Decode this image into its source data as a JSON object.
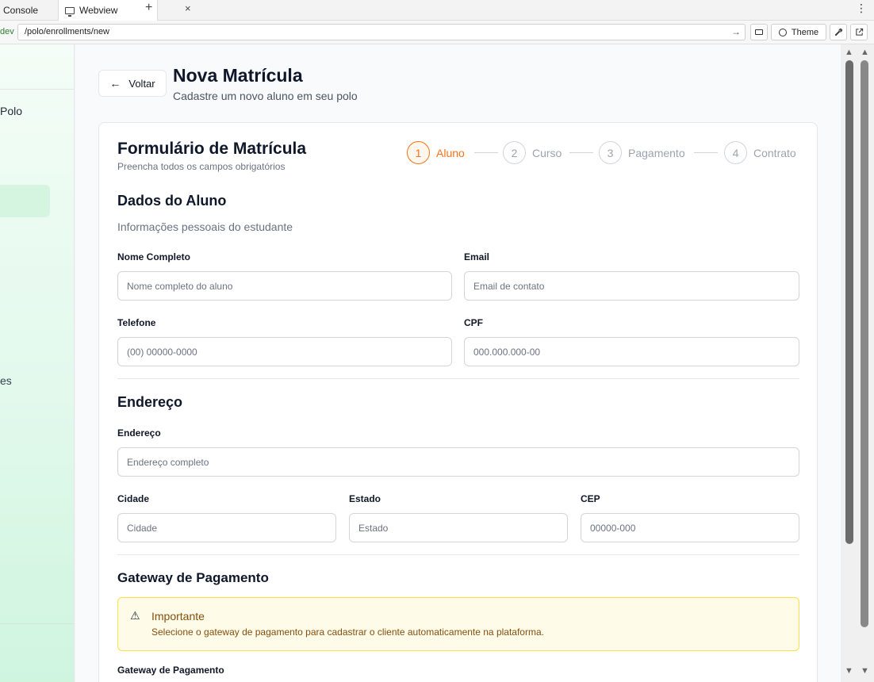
{
  "browser": {
    "tabs": [
      {
        "label": "Console"
      },
      {
        "label": "Webview"
      }
    ],
    "tab_close": "×",
    "new_tab": "+",
    "more": "⋮",
    "host_fragment": "dev",
    "url": "/polo/enrollments/new",
    "go": "→",
    "theme_label": "Theme"
  },
  "sidebar": {
    "title_fragment": "Polo",
    "item_fragment": "es"
  },
  "header": {
    "back_label": "Voltar",
    "back_arrow": "←",
    "title": "Nova Matrícula",
    "subtitle": "Cadastre um novo aluno em seu polo"
  },
  "form": {
    "title": "Formulário de Matrícula",
    "subtitle": "Preencha todos os campos obrigatórios",
    "steps": [
      {
        "num": "1",
        "label": "Aluno",
        "active": true
      },
      {
        "num": "2",
        "label": "Curso",
        "active": false
      },
      {
        "num": "3",
        "label": "Pagamento",
        "active": false
      },
      {
        "num": "4",
        "label": "Contrato",
        "active": false
      }
    ],
    "student": {
      "heading": "Dados do Aluno",
      "description": "Informações pessoais do estudante",
      "name_label": "Nome Completo",
      "name_placeholder": "Nome completo do aluno",
      "email_label": "Email",
      "email_placeholder": "Email de contato",
      "phone_label": "Telefone",
      "phone_placeholder": "(00) 00000-0000",
      "cpf_label": "CPF",
      "cpf_placeholder": "000.000.000-00"
    },
    "address": {
      "heading": "Endereço",
      "address_label": "Endereço",
      "address_placeholder": "Endereço completo",
      "city_label": "Cidade",
      "city_placeholder": "Cidade",
      "state_label": "Estado",
      "state_placeholder": "Estado",
      "cep_label": "CEP",
      "cep_placeholder": "00000-000"
    },
    "gateway": {
      "heading": "Gateway de Pagamento",
      "alert_icon": "⚠",
      "alert_title": "Importante",
      "alert_text": "Selecione o gateway de pagamento para cadastrar o cliente automaticamente na plataforma.",
      "field_label": "Gateway de Pagamento"
    }
  },
  "colors": {
    "accent": "#f97316",
    "alert_bg": "#fefce8",
    "alert_border": "#fde047",
    "sidebar_active": "#d6f5e1"
  }
}
